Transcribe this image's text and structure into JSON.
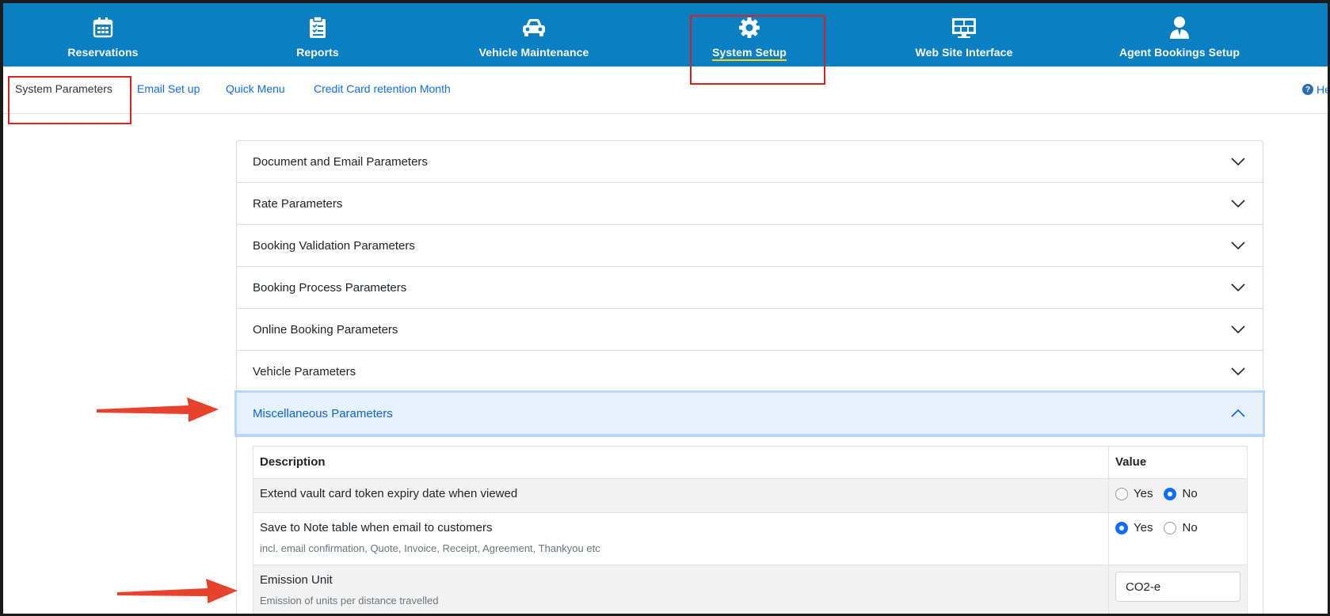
{
  "topnav": {
    "items": [
      {
        "label": "Reservations",
        "icon": "calendar-icon"
      },
      {
        "label": "Reports",
        "icon": "clipboard-icon"
      },
      {
        "label": "Vehicle Maintenance",
        "icon": "car-icon"
      },
      {
        "label": "System Setup",
        "icon": "gear-icon"
      },
      {
        "label": "Web Site Interface",
        "icon": "monitor-icon"
      },
      {
        "label": "Agent Bookings Setup",
        "icon": "agent-icon"
      }
    ],
    "active": "System Setup",
    "background": "#0a7fc2"
  },
  "subtabs": {
    "items": [
      {
        "label": "System Parameters"
      },
      {
        "label": "Email Set up"
      },
      {
        "label": "Quick Menu"
      },
      {
        "label": "Credit Card retention Month"
      }
    ],
    "active": "System Parameters",
    "help_label": "He"
  },
  "accordion": {
    "sections": [
      {
        "label": "Document and Email Parameters"
      },
      {
        "label": "Rate Parameters"
      },
      {
        "label": "Booking Validation Parameters"
      },
      {
        "label": "Booking Process Parameters"
      },
      {
        "label": "Online Booking Parameters"
      },
      {
        "label": "Vehicle Parameters"
      },
      {
        "label": "Miscellaneous Parameters"
      }
    ],
    "expanded": "Miscellaneous Parameters"
  },
  "table": {
    "headers": {
      "description": "Description",
      "value": "Value"
    },
    "rows": [
      {
        "description": "Extend vault card token expiry date when viewed",
        "note": "",
        "yes_label": "Yes",
        "no_label": "No",
        "selected": "No"
      },
      {
        "description": "Save to Note table when email to customers",
        "note": "incl. email confirmation, Quote, Invoice, Receipt, Agreement, Thankyou etc",
        "yes_label": "Yes",
        "no_label": "No",
        "selected": "Yes"
      },
      {
        "description": "Emission Unit",
        "note": "Emission of units per distance travelled",
        "input_value": "CO2-e"
      }
    ]
  },
  "colors": {
    "accent": "#0d6efd",
    "highlight_box": "#e02020",
    "annotation_arrow": "#e8412c"
  }
}
